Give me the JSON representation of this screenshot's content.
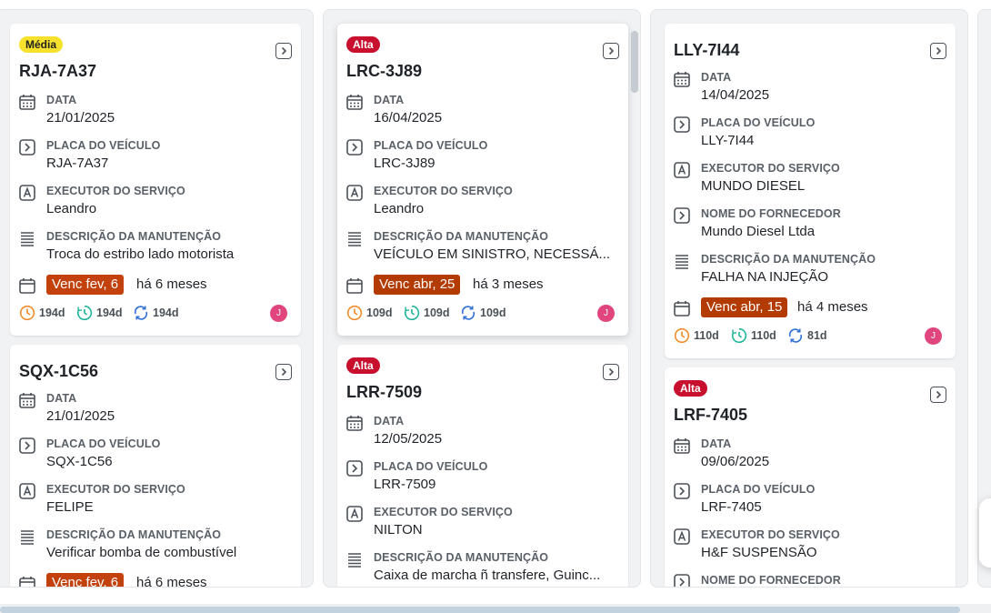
{
  "labels": {
    "data": "DATA",
    "placa": "PLACA DO VEÍCULO",
    "executor": "EXECUTOR DO SERVIÇO",
    "descricao": "DESCRIÇÃO DA MANUTENÇÃO",
    "fornecedor": "NOME DO FORNECEDOR"
  },
  "columns": [
    {
      "cards": [
        {
          "priority": "Média",
          "priority_color": "#f6e12c",
          "title": "RJA-7A37",
          "data": "21/01/2025",
          "placa": "RJA-7A37",
          "executor": "Leandro",
          "descricao": "Troca do estribo lado motorista",
          "venc": "Venc fev, 6",
          "ago": "há 6 meses",
          "stats": [
            "194d",
            "194d",
            "194d"
          ],
          "avatar": "J"
        },
        {
          "title": "SQX-1C56",
          "data": "21/01/2025",
          "placa": "SQX-1C56",
          "executor": "FELIPE",
          "descricao": "Verificar bomba de combustível",
          "venc": "Venc fev, 6",
          "ago": "há 6 meses"
        }
      ]
    },
    {
      "cards": [
        {
          "priority": "Alta",
          "priority_color": "#c8102e",
          "title": "LRC-3J89",
          "data": "16/04/2025",
          "placa": "LRC-3J89",
          "executor": "Leandro",
          "descricao": "VEÍCULO EM SINISTRO, NECESSÁ...",
          "venc": "Venc abr, 25",
          "ago": "há 3 meses",
          "stats": [
            "109d",
            "109d",
            "109d"
          ],
          "avatar": "J"
        },
        {
          "priority": "Alta",
          "priority_color": "#c8102e",
          "title": "LRR-7509",
          "data": "12/05/2025",
          "placa": "LRR-7509",
          "executor": "NILTON",
          "descricao": "Caixa de marcha ñ transfere, Guinc..."
        }
      ]
    },
    {
      "cards": [
        {
          "title": "LLY-7I44",
          "data": "14/04/2025",
          "placa": "LLY-7I44",
          "executor": "MUNDO DIESEL",
          "fornecedor": "Mundo Diesel Ltda",
          "descricao": "FALHA NA INJEÇÃO",
          "venc": "Venc abr, 15",
          "ago": "há 4 meses",
          "stats": [
            "110d",
            "110d",
            "81d"
          ],
          "avatar": "J"
        },
        {
          "priority": "Alta",
          "priority_color": "#c8102e",
          "title": "LRF-7405",
          "data": "09/06/2025",
          "placa": "LRF-7405",
          "executor": "H&F SUSPENSÃO"
        }
      ]
    }
  ],
  "icons": {
    "calendar": "calendar-icon",
    "plate": "chevron-square-icon",
    "executor": "letter-a-square-icon",
    "description": "list-lines-icon",
    "due": "due-calendar-icon",
    "clock": "clock-icon",
    "timer": "timer-icon",
    "sync": "sync-icon",
    "open": "open-card-icon"
  },
  "colors": {
    "alta": "#c8102e",
    "media": "#f6e12c",
    "venc": "#c2410c",
    "avatar": "#e0457b",
    "clock": "#f08c2a",
    "timer": "#1fb59a",
    "sync": "#2f6fd6"
  }
}
